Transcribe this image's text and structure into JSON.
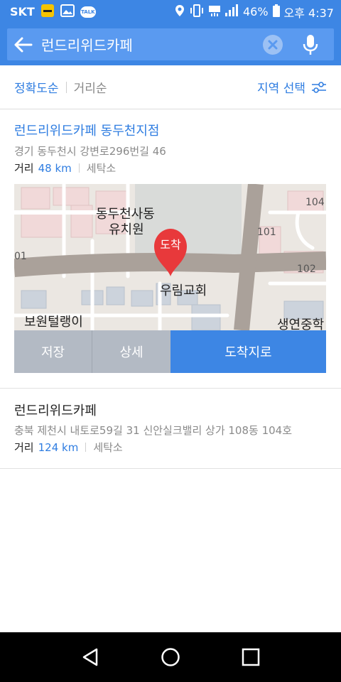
{
  "status_bar": {
    "carrier": "SKT",
    "battery": "46%",
    "time": "오후 4:37",
    "talk_badge": "TALK",
    "notif_icons": [
      "notification-badge-icon",
      "gallery-icon",
      "kakaotalk-icon"
    ],
    "system_icons": [
      "location-icon",
      "vibrate-icon",
      "lte-icon",
      "signal-icon",
      "battery-icon"
    ]
  },
  "search": {
    "query": "런드리위드카페",
    "back_icon": "arrow-left-icon",
    "clear_icon": "clear-icon",
    "mic_icon": "mic-icon"
  },
  "sort": {
    "active": "정확도순",
    "inactive": "거리순",
    "region": "지역 선택",
    "region_icon": "filter-sliders-icon"
  },
  "results": [
    {
      "title": "런드리위드카페 동두천지점",
      "address": "경기 동두천시 강변로296번길 46",
      "distance_label": "거리",
      "distance": "48 km",
      "category": "세탁소",
      "map": {
        "labels": [
          "동두천사동",
          "유치원",
          "우림교회",
          "보원털랭이",
          "생연중학",
          "104",
          "101",
          "102",
          "01"
        ],
        "pin_text": "도착",
        "pin_color": "#e8393b"
      },
      "actions": {
        "save": "저장",
        "detail": "상세",
        "route": "도착지로"
      }
    },
    {
      "title": "런드리위드카페",
      "address": "충북 제천시 내토로59길 31 신안실크밸리 상가 108동 104호",
      "distance_label": "거리",
      "distance": "124 km",
      "category": "세탁소"
    }
  ],
  "nav": {
    "back_icon": "nav-back-icon",
    "home_icon": "nav-home-icon",
    "recent_icon": "nav-recent-icon"
  },
  "colors": {
    "accent": "#3d86e4",
    "link_blue": "#2f7de1",
    "button_gray": "#b3bac4"
  }
}
